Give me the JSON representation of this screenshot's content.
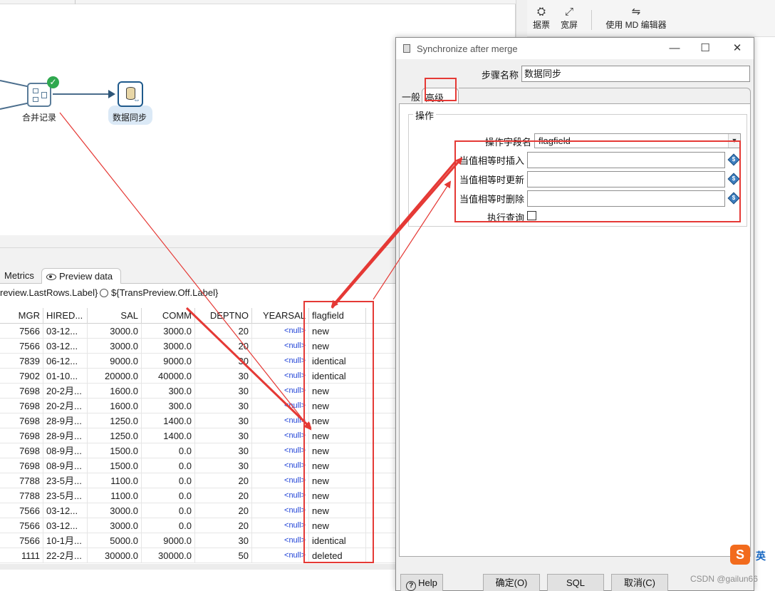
{
  "canvas": {
    "steps": {
      "merge_label": "合并记录",
      "sync_label": "数据同步"
    }
  },
  "toolbar": {
    "partial_label": "据票",
    "fullscreen_label": "宽屏",
    "md_editor_label": "使用 MD 编辑器"
  },
  "preview": {
    "tabs": {
      "metrics": "Metrics",
      "preview_data": "Preview data"
    },
    "radio_last_rows": "review.LastRows.Label}",
    "radio_off": "${TransPreview.Off.Label}",
    "columns": [
      "MGR",
      "HIRED...",
      "SAL",
      "COMM",
      "DEPTNO",
      "YEARSAL",
      "flagfield"
    ],
    "rows": [
      [
        "7566",
        "03-12...",
        "3000.0",
        "3000.0",
        "20",
        "<null>",
        "new"
      ],
      [
        "7566",
        "03-12...",
        "3000.0",
        "3000.0",
        "20",
        "<null>",
        "new"
      ],
      [
        "7839",
        "06-12...",
        "9000.0",
        "9000.0",
        "30",
        "<null>",
        "identical"
      ],
      [
        "7902",
        "01-10...",
        "20000.0",
        "40000.0",
        "30",
        "<null>",
        "identical"
      ],
      [
        "7698",
        "20-2月...",
        "1600.0",
        "300.0",
        "30",
        "<null>",
        "new"
      ],
      [
        "7698",
        "20-2月...",
        "1600.0",
        "300.0",
        "30",
        "<null>",
        "new"
      ],
      [
        "7698",
        "28-9月...",
        "1250.0",
        "1400.0",
        "30",
        "<null>",
        "new"
      ],
      [
        "7698",
        "28-9月...",
        "1250.0",
        "1400.0",
        "30",
        "<null>",
        "new"
      ],
      [
        "7698",
        "08-9月...",
        "1500.0",
        "0.0",
        "30",
        "<null>",
        "new"
      ],
      [
        "7698",
        "08-9月...",
        "1500.0",
        "0.0",
        "30",
        "<null>",
        "new"
      ],
      [
        "7788",
        "23-5月...",
        "1100.0",
        "0.0",
        "20",
        "<null>",
        "new"
      ],
      [
        "7788",
        "23-5月...",
        "1100.0",
        "0.0",
        "20",
        "<null>",
        "new"
      ],
      [
        "7566",
        "03-12...",
        "3000.0",
        "0.0",
        "20",
        "<null>",
        "new"
      ],
      [
        "7566",
        "03-12...",
        "3000.0",
        "0.0",
        "20",
        "<null>",
        "new"
      ],
      [
        "7566",
        "10-1月...",
        "5000.0",
        "9000.0",
        "30",
        "<null>",
        "identical"
      ],
      [
        "1111",
        "22-2月...",
        "30000.0",
        "30000.0",
        "50",
        "<null>",
        "deleted"
      ]
    ]
  },
  "dialog": {
    "title": "Synchronize after merge",
    "step_name_label": "步骤名称",
    "step_name_value": "数据同步",
    "tab_general": "一般",
    "tab_advanced": "高级",
    "group_title": "操作",
    "operation_field_label": "操作字段名",
    "operation_field_value": "flagfield",
    "insert_label": "当值相等时插入",
    "update_label": "当值相等时更新",
    "delete_label": "当值相等时删除",
    "perform_lookup_label": "执行查询",
    "insert_value": "",
    "update_value": "",
    "delete_value": "",
    "buttons": {
      "help": "Help",
      "ok": "确定(O)",
      "sql": "SQL",
      "cancel": "取消(C)"
    },
    "window_controls": {
      "minimize": "—",
      "maximize": "☐",
      "close": "✕"
    }
  },
  "overlay": {
    "watermark": "CSDN @gailun66",
    "ime_logo": "S",
    "ime_lang": "英"
  },
  "colors": {
    "annotation_red": "#e53935",
    "null_blue": "#1c3fd6",
    "success_green": "#2fa84f"
  }
}
